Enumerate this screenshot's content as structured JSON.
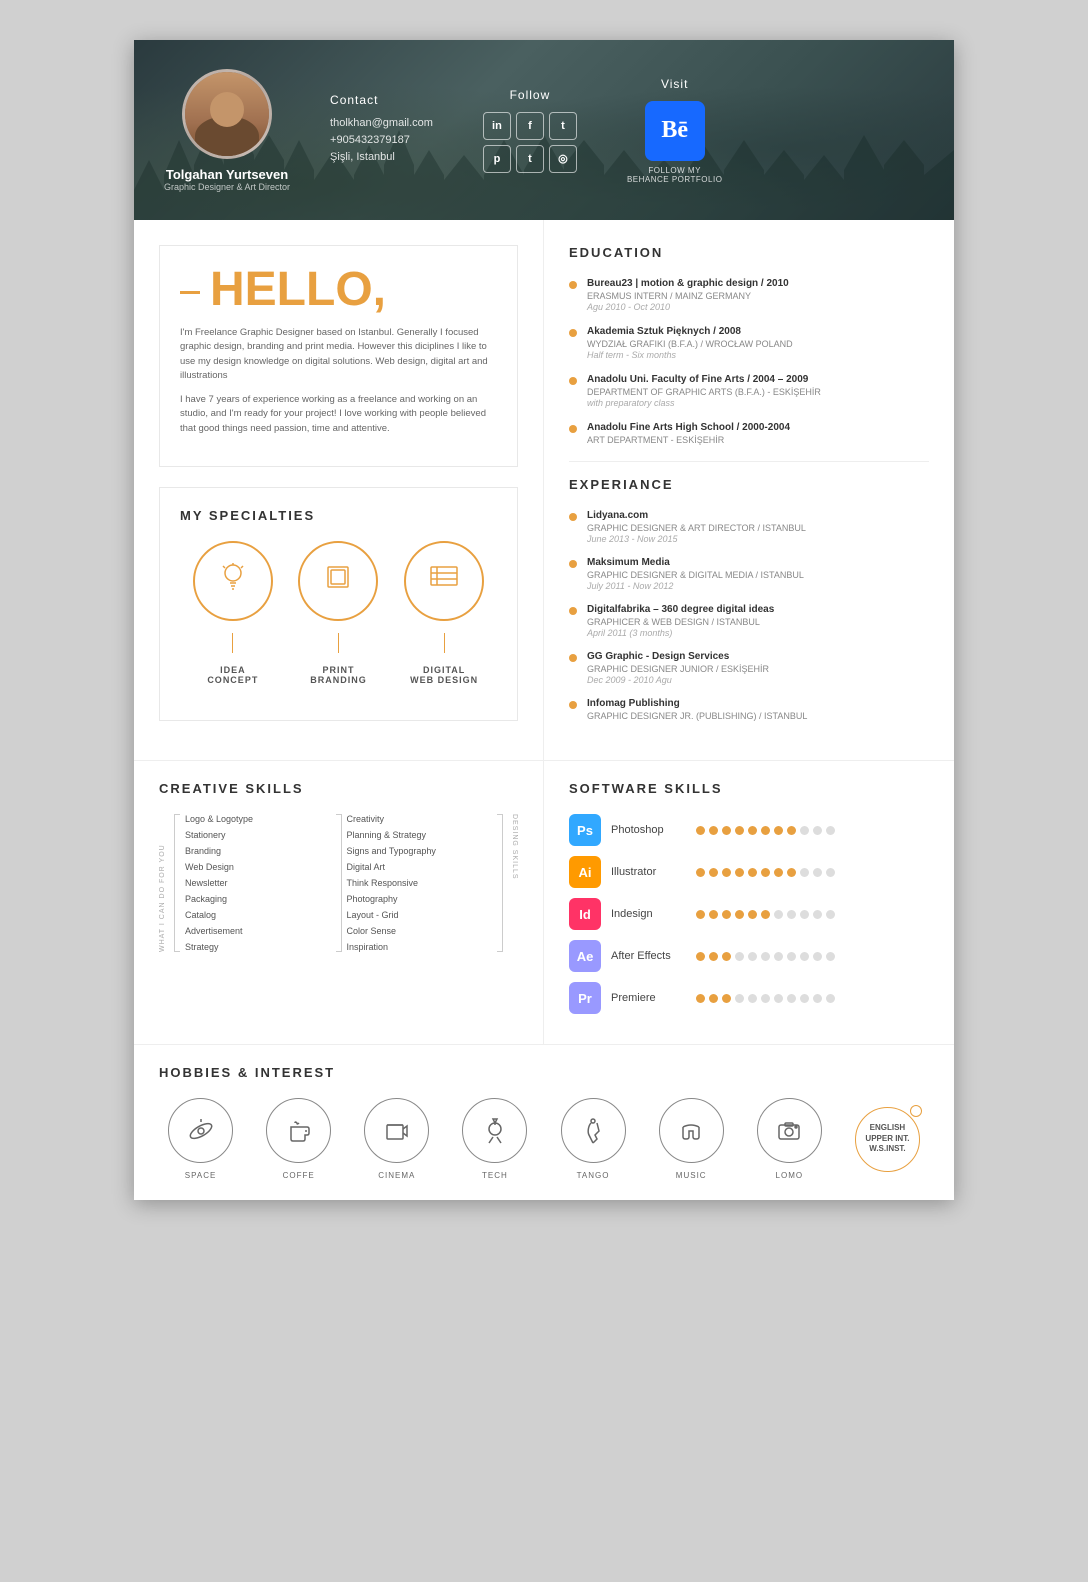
{
  "header": {
    "name": "Tolgahan Yurtseven",
    "title": "Graphic Designer & Art Director",
    "contact": {
      "label": "Contact",
      "email": "tholkhan@gmail.com",
      "phone": "+905432379187",
      "location": "Şişli, Istanbul"
    },
    "follow": {
      "label": "Follow",
      "icons": [
        "in",
        "f",
        "t",
        "p",
        "t",
        "◎"
      ]
    },
    "visit": {
      "label": "Visit",
      "behance": "Bē",
      "follow_text": "FOLLOW MY\nBEHANCE PORTFOLIO"
    }
  },
  "hello": {
    "title": "HELLO,",
    "para1": "I'm Freelance Graphic Designer based on Istanbul. Generally I focused graphic design, branding and print media. However this diciplines I like to use my design knowledge on digital solutions. Web design, digital art and illustrations",
    "para2": "I have 7 years of experience working as a freelance and working on an studio, and I'm ready for your project! I love working with people believed that good things need passion, time and attentive."
  },
  "specialties": {
    "title": "MY SPECIALTIES",
    "items": [
      {
        "icon": "💡",
        "line1": "IDEA",
        "line2": "CONCEPT"
      },
      {
        "icon": "🖨",
        "line1": "PRINT",
        "line2": "BRANDING"
      },
      {
        "icon": "🖥",
        "line1": "DIGITAL",
        "line2": "WEB DESIGN"
      }
    ]
  },
  "education": {
    "title": "EDUCATION",
    "items": [
      {
        "title": "Bureau23 | motion & graphic design / 2010",
        "sub": "ERASMUS INTERN / MAINZ GERMANY",
        "date": "Agu 2010 - Oct 2010"
      },
      {
        "title": "Akademia Sztuk Pięknych / 2008",
        "sub": "WYDZIAŁ GRAFIKI (B.F.A.) / WROCŁAW POLAND",
        "date": "Half term - Six months"
      },
      {
        "title": "Anadolu Uni. Faculty of Fine Arts / 2004 – 2009",
        "sub": "DEPARTMENT OF GRAPHIC ARTS (B.F.A.) - ESKİŞEHİR",
        "date": "with preparatory class"
      },
      {
        "title": "Anadolu Fine Arts High School / 2000-2004",
        "sub": "ART DEPARTMENT - ESKİŞEHİR",
        "date": ""
      }
    ]
  },
  "experience": {
    "title": "EXPERIANCE",
    "items": [
      {
        "title": "Lidyana.com",
        "sub": "GRAPHIC DESIGNER & ART DIRECTOR / ISTANBUL",
        "date": "June 2013 - Now 2015"
      },
      {
        "title": "Maksimum Media",
        "sub": "GRAPHIC DESIGNER & DIGITAL MEDIA / ISTANBUL",
        "date": "July 2011 - Now 2012"
      },
      {
        "title": "Digitalfabrika – 360 degree digital ideas",
        "sub": "GRAPHICER & WEB DESIGN / ISTANBUL",
        "date": "April 2011 (3 months)"
      },
      {
        "title": "GG Graphic - Design Services",
        "sub": "GRAPHIC DESIGNER JUNIOR / ESKİŞEHİR",
        "date": "Dec 2009 - 2010 Agu"
      },
      {
        "title": "Infomag Publishing",
        "sub": "GRAPHIC DESIGNER JR. (PUBLISHING) / ISTANBUL",
        "date": ""
      }
    ]
  },
  "creative_skills": {
    "title": "CREATIVE SKILLS",
    "left_label": "WHAT I CAN DO FOR YOU",
    "right_label": "DESING SKILLS",
    "left_items": [
      "Logo & Logotype",
      "Stationery",
      "Branding",
      "Web Design",
      "Newsletter",
      "Packaging",
      "Catalog",
      "Advertisement",
      "Strategy"
    ],
    "right_items": [
      "Creativity",
      "Planning & Strategy",
      "Signs and Typography",
      "Digital Art",
      "Think Responsive",
      "Photography",
      "Layout - Grid",
      "Color Sense",
      "Inspiration"
    ]
  },
  "software_skills": {
    "title": "SOFTWARE SKILLS",
    "items": [
      {
        "name": "Photoshop",
        "abbr": "Ps",
        "color": "#31a8ff",
        "filled": 8,
        "empty": 3
      },
      {
        "name": "Illustrator",
        "abbr": "Ai",
        "color": "#ff9a00",
        "filled": 8,
        "empty": 3
      },
      {
        "name": "Indesign",
        "abbr": "Id",
        "color": "#ff3366",
        "filled": 6,
        "empty": 5
      },
      {
        "name": "After Effects",
        "abbr": "Ae",
        "color": "#9999ff",
        "filled": 3,
        "empty": 8
      },
      {
        "name": "Premiere",
        "abbr": "Pr",
        "color": "#9999ff",
        "filled": 3,
        "empty": 8
      }
    ]
  },
  "hobbies": {
    "title": "HOBBIES & INTEREST",
    "items": [
      {
        "icon": "🔭",
        "label": "SPACE"
      },
      {
        "icon": "☕",
        "label": "COFFE"
      },
      {
        "icon": "🎬",
        "label": "CINEMA"
      },
      {
        "icon": "🚀",
        "label": "TECH"
      },
      {
        "icon": "👠",
        "label": "TANGO"
      },
      {
        "icon": "🎧",
        "label": "MUSIC"
      },
      {
        "icon": "📷",
        "label": "LOMO"
      }
    ],
    "language": {
      "line1": "ENGLISH",
      "line2": "UPPER INT.",
      "line3": "W.S.INST."
    }
  }
}
